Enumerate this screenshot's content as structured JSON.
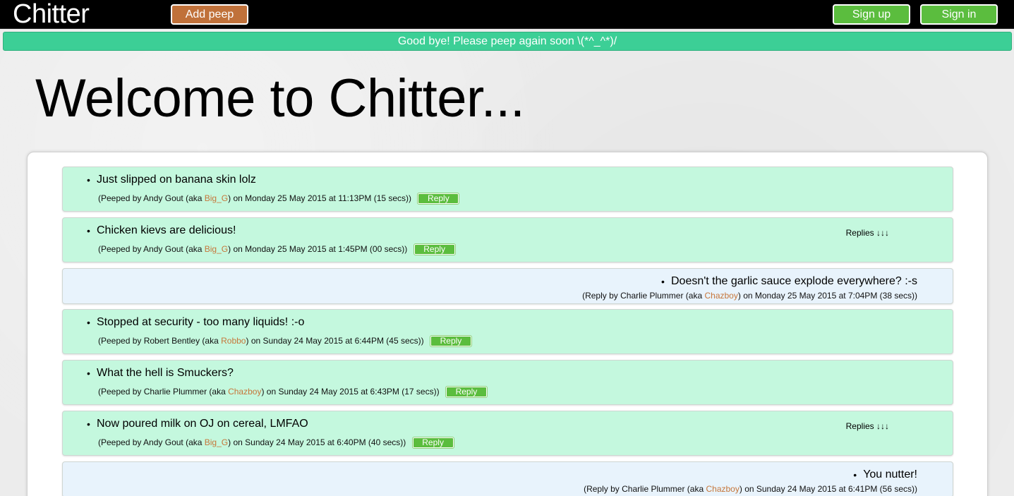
{
  "nav": {
    "brand": "Chitter",
    "add_peep": "Add peep",
    "sign_up": "Sign up",
    "sign_in": "Sign in"
  },
  "flash": "Good bye! Please peep again soon \\(*^_^*)/",
  "heading": "Welcome to Chitter...",
  "ui": {
    "reply_label": "Reply",
    "replies_label": "Replies ↓↓↓"
  },
  "items": [
    {
      "kind": "peep",
      "text": "Just slipped on banana skin lolz",
      "prefix": "(Peeped by Andy Gout (aka ",
      "handle": "Big_G",
      "suffix": ") on Monday 25 May 2015 at 11:13PM (15 secs))"
    },
    {
      "kind": "peep",
      "text": "Chicken kievs are delicious!",
      "prefix": "(Peeped by Andy Gout (aka ",
      "handle": "Big_G",
      "suffix": ") on Monday 25 May 2015 at 1:45PM (00 secs))"
    },
    {
      "kind": "reply",
      "text": "Doesn't the garlic sauce explode everywhere? :-s",
      "prefix": "(Reply by Charlie Plummer (aka ",
      "handle": "Chazboy",
      "suffix": ") on Monday 25 May 2015 at 7:04PM (38 secs))"
    },
    {
      "kind": "peep",
      "text": "Stopped at security - too many liquids! :-o",
      "prefix": "(Peeped by Robert Bentley (aka ",
      "handle": "Robbo",
      "suffix": ") on Sunday 24 May 2015 at 6:44PM (45 secs))"
    },
    {
      "kind": "peep",
      "text": "What the hell is Smuckers?",
      "prefix": "(Peeped by Charlie Plummer (aka ",
      "handle": "Chazboy",
      "suffix": ") on Sunday 24 May 2015 at 6:43PM (17 secs))"
    },
    {
      "kind": "peep",
      "text": "Now poured milk on OJ on cereal, LMFAO",
      "prefix": "(Peeped by Andy Gout (aka ",
      "handle": "Big_G",
      "suffix": ") on Sunday 24 May 2015 at 6:40PM (40 secs))"
    },
    {
      "kind": "reply",
      "text": "You nutter!",
      "prefix": "(Reply by Charlie Plummer (aka ",
      "handle": "Chazboy",
      "suffix": ") on Sunday 24 May 2015 at 6:41PM (56 secs))"
    }
  ],
  "colors": {
    "peep_bg": "#c4f8de",
    "reply_bg": "#e8f3fc",
    "green_button": "#5bbd3e",
    "orange_button": "#c0713a",
    "flash_bg": "#3ccf96",
    "handle": "#c6763a"
  }
}
